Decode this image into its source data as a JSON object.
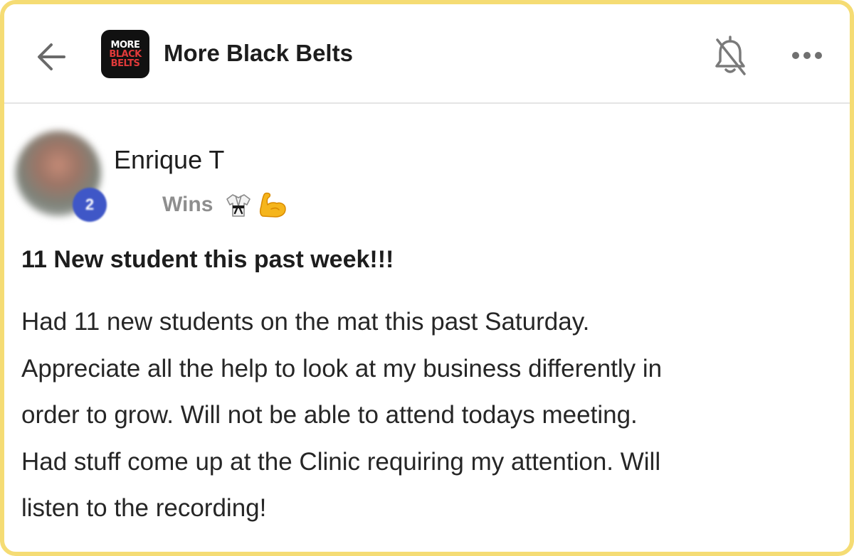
{
  "header": {
    "back_icon": "arrow-left-icon",
    "logo": {
      "line1": "MORE",
      "line2": "BLACK",
      "line3": "BELTS"
    },
    "group_name": "More Black Belts",
    "notification_icon": "bell-off-icon",
    "more_icon": "more-horizontal-icon"
  },
  "author": {
    "name": "Enrique T",
    "level": "2",
    "category": "Wins",
    "category_emojis": [
      "martial-arts-uniform-icon",
      "flexed-biceps-icon"
    ]
  },
  "post": {
    "title": "11 New student this past week!!!",
    "body_lines": [
      "Had 11 new students on the mat this past Saturday.",
      "Appreciate all the help to look at my business differently in",
      "order to grow. Will not be able to attend todays meeting.",
      "Had stuff come up at the Clinic requiring my attention. Will",
      "listen to the recording!"
    ]
  },
  "colors": {
    "frame_border": "#f5dc74",
    "level_badge": "#3f57c7",
    "logo_red": "#e23a3a",
    "text": "#1d1d1d",
    "muted": "#8e8e8e"
  }
}
